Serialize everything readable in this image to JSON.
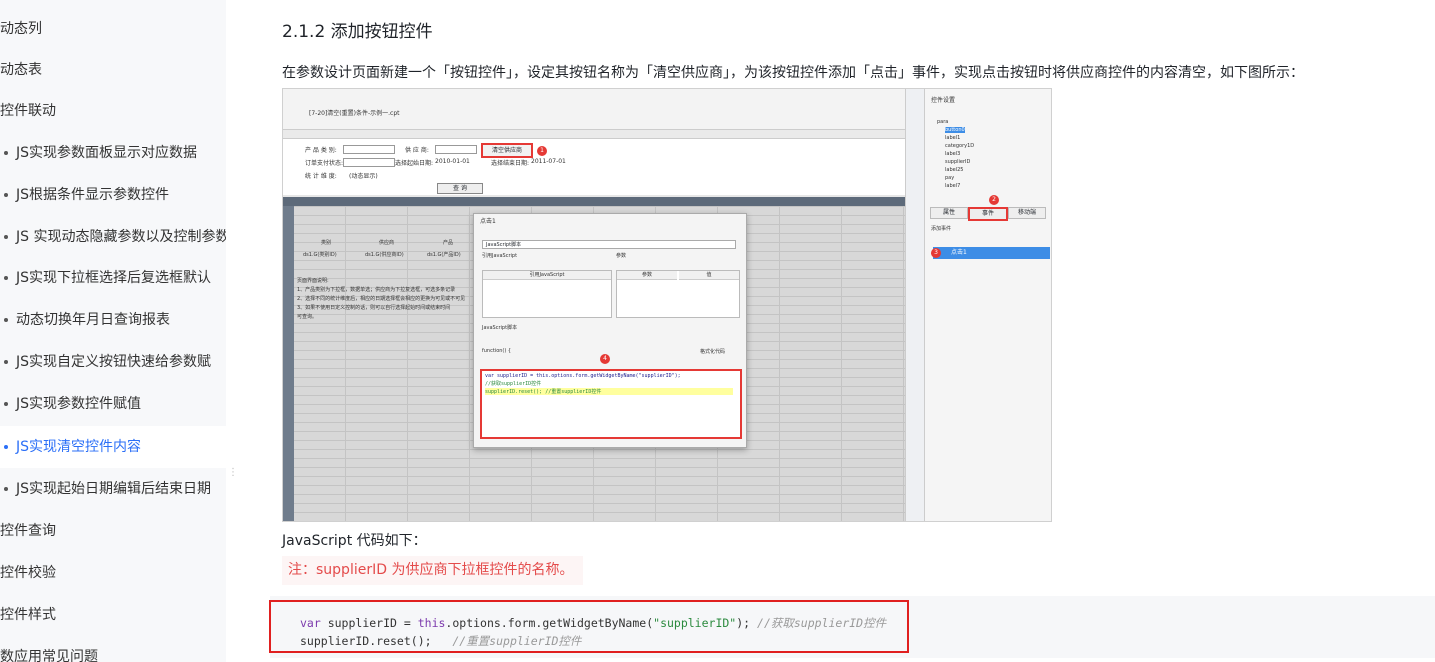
{
  "sidebar": {
    "items": [
      {
        "label": "动态列",
        "child": false,
        "active": false
      },
      {
        "label": "动态表",
        "child": false,
        "active": false
      },
      {
        "label": "控件联动",
        "child": false,
        "active": false
      },
      {
        "label": "JS实现参数面板显示对应数据",
        "child": true,
        "active": false
      },
      {
        "label": "JS根据条件显示参数控件",
        "child": true,
        "active": false
      },
      {
        "label": "JS 实现动态隐藏参数以及控制参数",
        "child": true,
        "active": false
      },
      {
        "label": "JS实现下拉框选择后复选框默认",
        "child": true,
        "active": false
      },
      {
        "label": "动态切换年月日查询报表",
        "child": true,
        "active": false
      },
      {
        "label": "JS实现自定义按钮快速给参数赋",
        "child": true,
        "active": false
      },
      {
        "label": "JS实现参数控件赋值",
        "child": true,
        "active": false
      },
      {
        "label": "JS实现清空控件内容",
        "child": true,
        "active": true
      },
      {
        "label": "JS实现起始日期编辑后结束日期",
        "child": true,
        "active": false
      },
      {
        "label": "控件查询",
        "child": false,
        "active": false
      },
      {
        "label": "控件校验",
        "child": false,
        "active": false
      },
      {
        "label": "控件样式",
        "child": false,
        "active": false
      },
      {
        "label": "数应用常见问题",
        "child": false,
        "active": false
      }
    ]
  },
  "content": {
    "heading": "2.1.2 添加按钮控件",
    "paragraph": "在参数设计页面新建一个「按钮控件」，设定其按钮名称为「清空供应商」，为该按钮控件添加「点击」事件，实现点击按钮时将供应商控件的内容清空，如下图所示：",
    "js_label": "JavaScript 代码如下：",
    "note": "注：supplierID 为供应商下拉框控件的名称。",
    "code": {
      "line1_kw": "var",
      "line1_a": " supplierID = ",
      "line1_this": "this",
      "line1_b": ".options.form.getWidgetByName(",
      "line1_str": "\"supplierID\"",
      "line1_c": "); ",
      "line1_comment": "//获取supplierID控件",
      "line2_a": "supplierID.reset();   ",
      "line2_comment": "//重置supplierID控件"
    }
  },
  "figure": {
    "tab": "[7-20]清空(重置)条件-示例一.cpt",
    "params": {
      "p1": "产 品 类 别:",
      "p2": "供 应 商:",
      "p3": "订单支付状态:",
      "p4": "选择起始日期:",
      "p4v": "2010-01-01",
      "p5": "选择结束日期:",
      "p5v": "2011-07-01",
      "p6": "统 计 维 度:",
      "p6v": "(动态显示)",
      "query": "查 询",
      "clear_btn": "清空供应商"
    },
    "grid_cells": {
      "c1": "类别",
      "c2": "供应商",
      "c3": "产品",
      "c4": "ds1.G(类别ID)",
      "c5": "ds1.G(供应商ID)",
      "c6": "ds1.G(产品ID)",
      "notes_title": "页面界面说明:",
      "n1": "1、产品类别为下拉框，数据单选；供应商为下拉复选框，可选多条记录",
      "n2": "2、选择不同的统计维度后，相应的日期选择框会相应的更换为可见或不可见",
      "n3": "3、如果不使用日定义控制的话，则可以自行选择起始时间或结束时间",
      "n4": "可查询。"
    },
    "right_panel": {
      "title": "控件设置",
      "tree": [
        "para",
        "button0",
        "label1",
        "category1D",
        "label3",
        "supplierID",
        "label25",
        "pay",
        "label7"
      ],
      "tab_attr": "属性",
      "tab_event": "事件",
      "tab_mobile": "移动端",
      "add_event": "添加事件",
      "event_item": "点击1"
    },
    "dialog": {
      "title": "点击1",
      "select": "JavaScript脚本",
      "ref_js": "引用JavaScript",
      "params": "参数",
      "col_ref": "引用JavaScript",
      "col_param": "参数",
      "col_value": "值",
      "script_label": "JavaScript脚本",
      "function_sig": "function() {",
      "format_code": "格式化代码",
      "code1": "var supplierID = this.options.form.getWidgetByName(\"supplierID\");",
      "code2": "//获取supplierID控件",
      "code3": "supplierID.reset(); //重置supplierID控件"
    },
    "badges": [
      "1",
      "2",
      "3",
      "4"
    ]
  }
}
